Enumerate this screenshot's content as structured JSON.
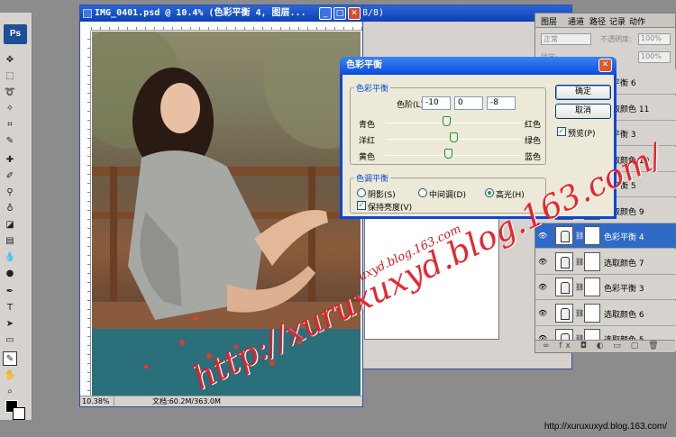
{
  "tools_panel": {
    "logo": "Ps"
  },
  "document": {
    "title": "IMG_0401.psd @ 10.4% (色彩平衡 4, 图层...",
    "zoom": "10.38%",
    "doc_info": "文档:60.2M/363.0M"
  },
  "document2": {
    "title_fragment": "B/8)"
  },
  "layers_panel": {
    "tabs": [
      "图层",
      "通道",
      "路径",
      "记录",
      "动作"
    ],
    "blend_mode": "正常",
    "opacity_label": "不透明度:",
    "opacity_value": "100%",
    "lock_label": "锁定:",
    "fill_value": "100%",
    "layers": [
      {
        "name": "彩平衡 6",
        "active": false
      },
      {
        "name": "选取颜色 11",
        "active": false
      },
      {
        "name": "彩平衡 3",
        "active": false
      },
      {
        "name": "选取颜色 10",
        "active": false
      },
      {
        "name": "彩平衡 5",
        "active": false
      },
      {
        "name": "选取颜色 9",
        "active": false
      },
      {
        "name": "色彩平衡 4",
        "active": true
      },
      {
        "name": "选取颜色 7",
        "active": false
      },
      {
        "name": "色彩平衡 3",
        "active": false
      },
      {
        "name": "选取颜色 6",
        "active": false
      },
      {
        "name": "选取颜色 5",
        "active": false
      }
    ],
    "footer_icons": "∞ fx ◘ ◐ ▭ ▢ 🗑"
  },
  "dialog": {
    "title": "色彩平衡",
    "group1_legend": "色彩平衡",
    "levels_label": "色阶(L):",
    "levels": [
      "-10",
      "0",
      "-8"
    ],
    "sliders": [
      {
        "left": "青色",
        "right": "红色",
        "value": -10
      },
      {
        "left": "洋红",
        "right": "绿色",
        "value": 0
      },
      {
        "left": "黄色",
        "right": "蓝色",
        "value": -8
      }
    ],
    "group2_legend": "色调平衡",
    "tones": [
      "阴影(S)",
      "中间调(D)",
      "高光(H)"
    ],
    "selected_tone": "高光(H)",
    "preserve_label": "保持亮度(V)",
    "preserve_checked": true,
    "ok_label": "确定",
    "cancel_label": "取消",
    "preview_label": "预览(P)",
    "preview_checked": true
  },
  "watermarks": {
    "big": "http://xuruxuxyd.blog.163.com/",
    "small": "uxyd.blog.163.com"
  },
  "footer_url": "http://xuruxuxyd.blog.163.com/"
}
